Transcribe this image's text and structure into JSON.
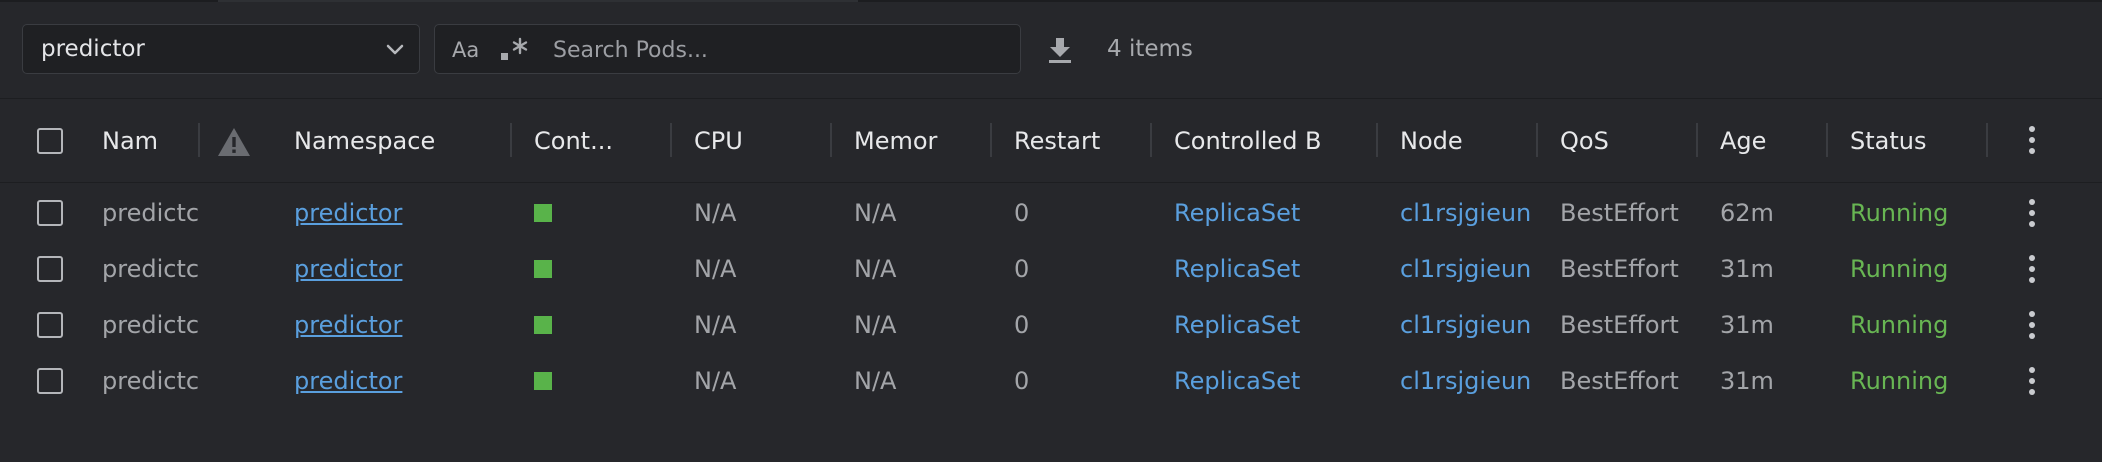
{
  "toolbar": {
    "namespace_value": "predictor",
    "search_case_label": "Aa",
    "search_placeholder": "Search Pods...",
    "items_count": "4 items"
  },
  "table": {
    "columns": [
      "Nam",
      "Namespace",
      "Cont...",
      "CPU",
      "Memor",
      "Restart",
      "Controlled B",
      "Node",
      "QoS",
      "Age",
      "Status"
    ],
    "rows": [
      {
        "name": "predictc",
        "namespace": "predictor",
        "cpu": "N/A",
        "memory": "N/A",
        "restarts": "0",
        "controlled_by": "ReplicaSet",
        "node": "cl1rsjgieun",
        "qos": "BestEffort",
        "age": "62m",
        "status": "Running"
      },
      {
        "name": "predictc",
        "namespace": "predictor",
        "cpu": "N/A",
        "memory": "N/A",
        "restarts": "0",
        "controlled_by": "ReplicaSet",
        "node": "cl1rsjgieun",
        "qos": "BestEffort",
        "age": "31m",
        "status": "Running"
      },
      {
        "name": "predictc",
        "namespace": "predictor",
        "cpu": "N/A",
        "memory": "N/A",
        "restarts": "0",
        "controlled_by": "ReplicaSet",
        "node": "cl1rsjgieun",
        "qos": "BestEffort",
        "age": "31m",
        "status": "Running"
      },
      {
        "name": "predictc",
        "namespace": "predictor",
        "cpu": "N/A",
        "memory": "N/A",
        "restarts": "0",
        "controlled_by": "ReplicaSet",
        "node": "cl1rsjgieun",
        "qos": "BestEffort",
        "age": "31m",
        "status": "Running"
      }
    ]
  },
  "icons": {
    "namespace_dropdown": "chevron-down-icon",
    "regex_toggle": "regex-icon",
    "download": "download-icon",
    "warning_column": "warning-icon",
    "row_menu": "kebab-menu-icon",
    "container_status": "container-status-icon"
  },
  "colors": {
    "background": "#26272b",
    "link": "#5a9fde",
    "running": "#68b653",
    "container_ready": "#59b34a"
  }
}
